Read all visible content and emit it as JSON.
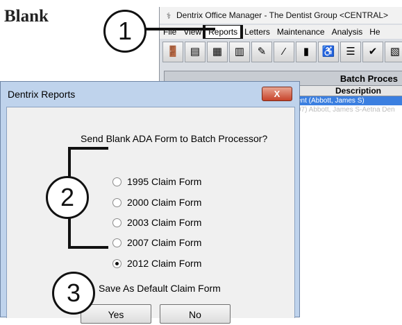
{
  "heading": "Blank",
  "app": {
    "title": "Dentrix Office Manager - The Dentist Group <CENTRAL>",
    "menu": [
      "File",
      "View",
      "Reports",
      "Letters",
      "Maintenance",
      "Analysis",
      "He"
    ],
    "toolbar_icons": [
      "door-icon",
      "card-icon",
      "ledger-icon",
      "book-icon",
      "pen-icon",
      "wand-icon",
      "binder-icon",
      "chair-icon",
      "list-icon",
      "check-icon",
      "chart-icon",
      "bolt-icon",
      "batch-icon"
    ],
    "grid_title": "Batch Proces",
    "grid_column": "Description",
    "rows": [
      "ent (Abbott, James S)",
      "97) Abbott, James S-Aetna Den"
    ]
  },
  "dialog": {
    "title": "Dentrix Reports",
    "close_glyph": "X",
    "prompt": "Send Blank ADA Form to Batch Processor?",
    "options": [
      {
        "label": "1995 Claim Form",
        "checked": false
      },
      {
        "label": "2000 Claim Form",
        "checked": false
      },
      {
        "label": "2003 Claim Form",
        "checked": false
      },
      {
        "label": "2007 Claim Form",
        "checked": false
      },
      {
        "label": "2012 Claim Form",
        "checked": true
      }
    ],
    "save_default": {
      "label": "Save As Default Claim Form",
      "checked": false
    },
    "yes_label": "Yes",
    "no_label": "No"
  },
  "callouts": [
    "1",
    "2",
    "3"
  ]
}
